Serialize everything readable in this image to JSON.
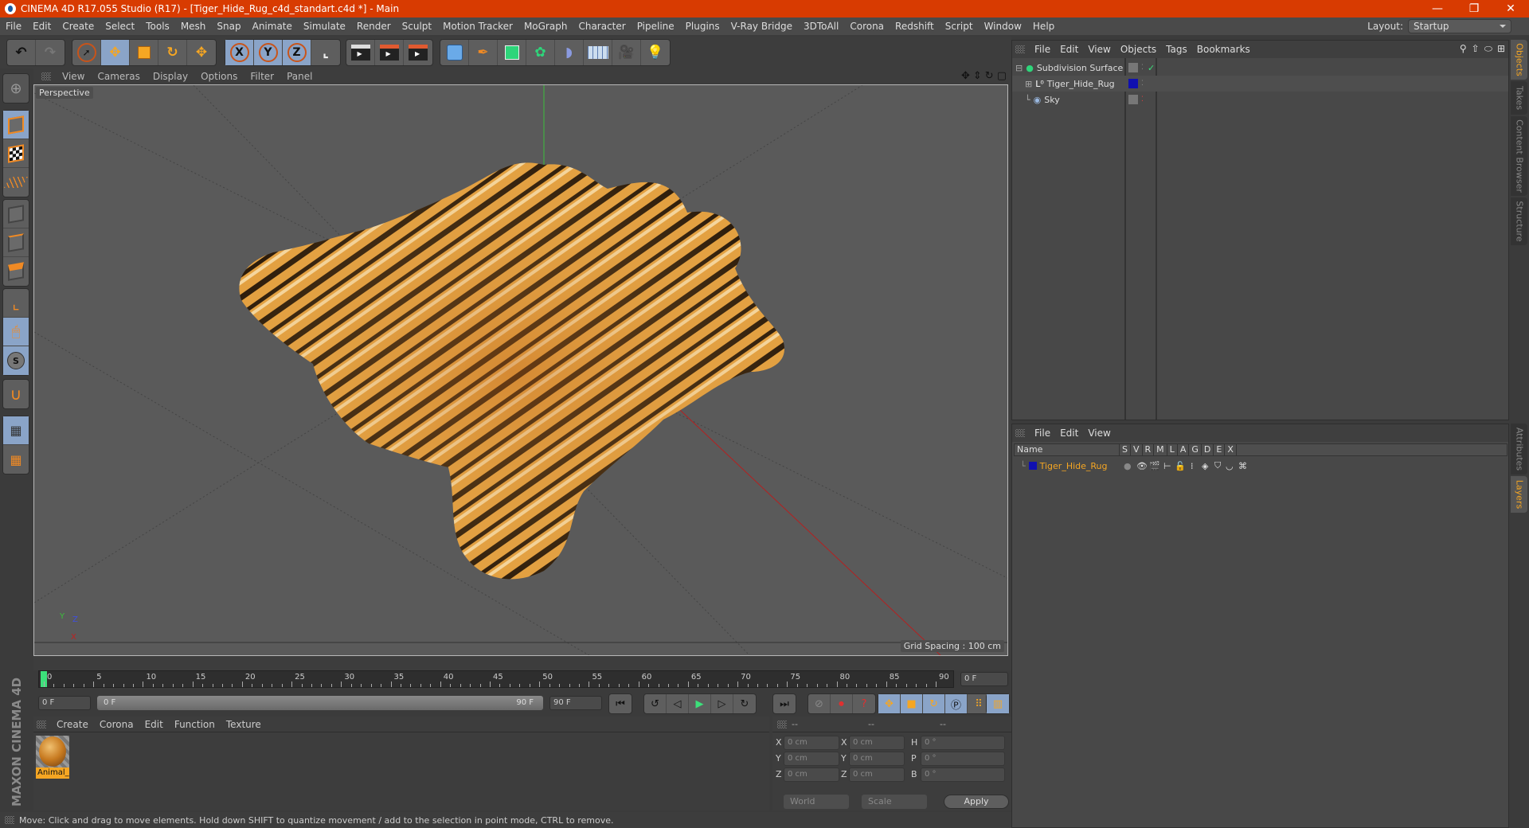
{
  "window": {
    "title": "CINEMA 4D R17.055 Studio (R17) - [Tiger_Hide_Rug_c4d_standart.c4d *] - Main",
    "controls": [
      "minimize-icon",
      "restore-icon",
      "close-icon"
    ]
  },
  "menu": [
    "File",
    "Edit",
    "Create",
    "Select",
    "Tools",
    "Mesh",
    "Snap",
    "Animate",
    "Simulate",
    "Render",
    "Sculpt",
    "Motion Tracker",
    "MoGraph",
    "Character",
    "Pipeline",
    "Plugins",
    "V-Ray Bridge",
    "3DToAll",
    "Corona",
    "Redshift",
    "Script",
    "Window",
    "Help"
  ],
  "layout": {
    "label": "Layout:",
    "value": "Startup"
  },
  "toolbar": {
    "groups": [
      [
        "undo-icon",
        "redo-icon"
      ],
      [
        "live-selection-icon",
        "move-icon",
        "scale-icon",
        "rotate-icon",
        "move-recent-icon"
      ],
      [
        "x-axis-icon",
        "y-axis-icon",
        "z-axis-icon",
        "coordinate-system-icon"
      ],
      [
        "render-view-icon",
        "render-picture-viewer-icon",
        "render-settings-icon"
      ],
      [
        "cube-icon",
        "pen-icon",
        "subdivision-icon",
        "cloner-icon",
        "deformer-icon",
        "floor-icon",
        "camera-icon",
        "light-icon"
      ]
    ],
    "axis_labels": [
      "X",
      "Y",
      "Z"
    ]
  },
  "left_toolbar": [
    "make-editable-icon",
    "model-mode-icon",
    "texture-mode-icon",
    "workplane-mode-icon",
    "points-mode-icon",
    "edges-mode-icon",
    "polygons-mode-icon",
    "axis-mode-icon",
    "tweak-mode-icon",
    "solo-icon",
    "snap-icon",
    "locked-workplane-icon",
    "workplane-icon"
  ],
  "viewport": {
    "menu": [
      "View",
      "Cameras",
      "Display",
      "Options",
      "Filter",
      "Panel"
    ],
    "label": "Perspective",
    "grid_spacing": "Grid Spacing : 100 cm",
    "nav_icons": [
      "move-view-icon",
      "zoom-view-icon",
      "rotate-view-icon",
      "toggle-view-icon"
    ],
    "axis": {
      "x": "X",
      "y": "Y",
      "z": "Z"
    }
  },
  "timeline": {
    "ticks": [
      "0",
      "5",
      "10",
      "15",
      "20",
      "25",
      "30",
      "35",
      "40",
      "45",
      "50",
      "55",
      "60",
      "65",
      "70",
      "75",
      "80",
      "85",
      "90"
    ],
    "current_frame": "0 F",
    "start_field": "0 F",
    "range_start": "0 F",
    "range_end": "90 F",
    "end_field": "90 F"
  },
  "materials": {
    "menu": [
      "Create",
      "Corona",
      "Edit",
      "Function",
      "Texture"
    ],
    "items": [
      {
        "name": "Animal_"
      }
    ]
  },
  "coordinates": {
    "headers": [
      "--",
      "--",
      "--"
    ],
    "rows": [
      {
        "l1": "X",
        "v1": "0 cm",
        "l2": "X",
        "v2": "0 cm",
        "l3": "H",
        "v3": "0 °"
      },
      {
        "l1": "Y",
        "v1": "0 cm",
        "l2": "Y",
        "v2": "0 cm",
        "l3": "P",
        "v3": "0 °"
      },
      {
        "l1": "Z",
        "v1": "0 cm",
        "l2": "Z",
        "v2": "0 cm",
        "l3": "B",
        "v3": "0 °"
      }
    ],
    "space": "World",
    "mode": "Scale",
    "apply": "Apply"
  },
  "brand": "MAXON CINEMA 4D",
  "status": "Move: Click and drag to move elements. Hold down SHIFT to quantize movement / add to the selection in point mode, CTRL to remove.",
  "objects_panel": {
    "menu": [
      "File",
      "Edit",
      "View",
      "Objects",
      "Tags",
      "Bookmarks"
    ],
    "objects": [
      {
        "name": "Subdivision Surface",
        "icon": "subdivision-icon",
        "color": "#888888",
        "check": "✓"
      },
      {
        "name": "Tiger_Hide_Rug",
        "icon": "null-object-icon",
        "color": "#1010b0"
      },
      {
        "name": "Sky",
        "icon": "sky-icon",
        "color": "#888888"
      }
    ]
  },
  "layers_panel": {
    "menu": [
      "File",
      "Edit",
      "View"
    ],
    "columns": [
      "Name",
      "S",
      "V",
      "R",
      "M",
      "L",
      "A",
      "G",
      "D",
      "E",
      "X"
    ],
    "layers": [
      {
        "name": "Tiger_Hide_Rug",
        "color": "#1010b0"
      }
    ]
  },
  "side_tabs": {
    "top": [
      "Objects",
      "Takes",
      "Content Browser",
      "Structure"
    ],
    "bottom": [
      "Attributes",
      "Layers"
    ]
  },
  "colors": {
    "accent": "#d83b01",
    "active_tab": "#f5a623",
    "selected": "#8aa4c8"
  }
}
